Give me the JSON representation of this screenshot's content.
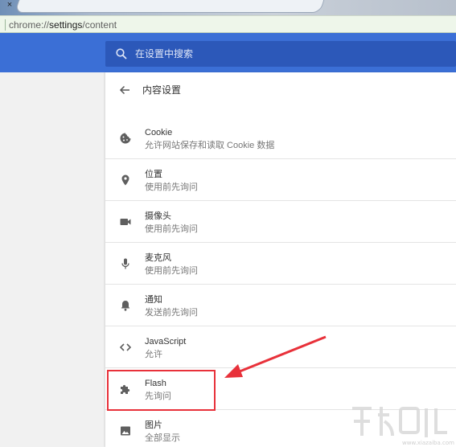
{
  "browser": {
    "tab_close_glyph": "×",
    "url_scheme": "chrome://",
    "url_host": "settings",
    "url_path": "/content"
  },
  "header": {
    "search_placeholder": "在设置中搜索",
    "search_icon": "search-icon"
  },
  "page": {
    "back_icon": "arrow-back-icon",
    "title": "内容设置"
  },
  "settings_items": [
    {
      "title": "Cookie",
      "subtitle": "允许网站保存和读取 Cookie 数据",
      "icon": "cookie-icon"
    },
    {
      "title": "位置",
      "subtitle": "使用前先询问",
      "icon": "location-pin-icon"
    },
    {
      "title": "摄像头",
      "subtitle": "使用前先询问",
      "icon": "camera-icon"
    },
    {
      "title": "麦克风",
      "subtitle": "使用前先询问",
      "icon": "microphone-icon"
    },
    {
      "title": "通知",
      "subtitle": "发送前先询问",
      "icon": "bell-icon"
    },
    {
      "title": "JavaScript",
      "subtitle": "允许",
      "icon": "code-icon"
    },
    {
      "title": "Flash",
      "subtitle": "先询问",
      "icon": "puzzle-icon"
    },
    {
      "title": "图片",
      "subtitle": "全部显示",
      "icon": "image-icon"
    }
  ],
  "annotation": {
    "highlight_color": "#e8313a",
    "highlighted_item": "Flash"
  },
  "colors": {
    "header_blue": "#3b6fd6",
    "search_bg": "#2c58b9",
    "address_bar_bg": "#eef6ea"
  }
}
